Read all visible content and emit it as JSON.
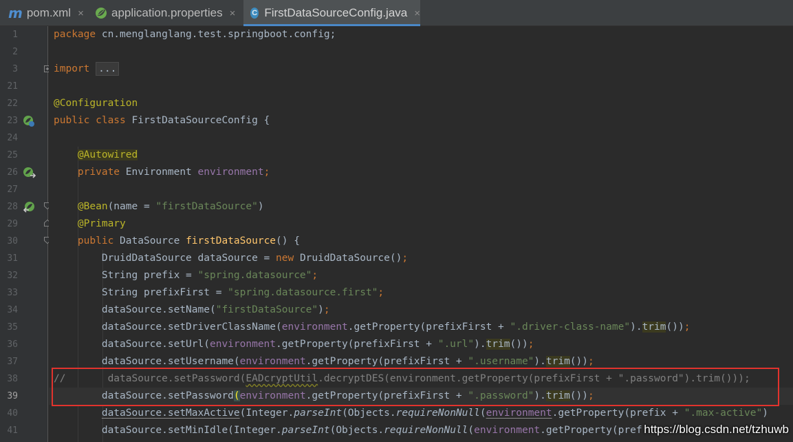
{
  "tabs": [
    {
      "label": "pom.xml",
      "icon": "maven-icon",
      "close": "×"
    },
    {
      "label": "application.properties",
      "icon": "spring-leaf-icon",
      "close": "×"
    },
    {
      "label": "FirstDataSourceConfig.java",
      "icon": "class-icon",
      "icon_glyph": "C",
      "close": "×",
      "active": true
    }
  ],
  "editor": {
    "lines": [
      {
        "num": "1"
      },
      {
        "num": "2"
      },
      {
        "num": "3"
      },
      {
        "num": "21"
      },
      {
        "num": "22"
      },
      {
        "num": "23"
      },
      {
        "num": "24"
      },
      {
        "num": "25"
      },
      {
        "num": "26"
      },
      {
        "num": "27"
      },
      {
        "num": "28"
      },
      {
        "num": "29"
      },
      {
        "num": "30"
      },
      {
        "num": "31"
      },
      {
        "num": "32"
      },
      {
        "num": "33"
      },
      {
        "num": "34"
      },
      {
        "num": "35"
      },
      {
        "num": "36"
      },
      {
        "num": "37"
      },
      {
        "num": "38"
      },
      {
        "num": "39"
      },
      {
        "num": "40"
      },
      {
        "num": "41"
      }
    ],
    "code": {
      "l1_kw": "package",
      "l1_rest": " cn.menglanglang.test.springboot.config;",
      "l3_kw": "import",
      "l3_fold": "...",
      "l22_ann": "@Configuration",
      "l23_kw": "public class",
      "l23_rest": " FirstDataSourceConfig {",
      "l25_ann": "@Autowired",
      "l26_kw": "private",
      "l26_type": " Environment ",
      "l26_field": "environment",
      "l26_semi": ";",
      "l28_ann": "@Bean",
      "l28_open": "(name = ",
      "l28_str": "\"firstDataSource\"",
      "l28_close": ")",
      "l29_ann": "@Primary",
      "l30_kw": "public",
      "l30_type": " DataSource ",
      "l30_fn": "firstDataSource",
      "l30_rest": "() {",
      "l31_a": "DruidDataSource dataSource = ",
      "l31_kw": "new",
      "l31_b": " DruidDataSource()",
      "l31_semi": ";",
      "l32_a": "String prefix = ",
      "l32_str": "\"spring.datasource\"",
      "l32_semi": ";",
      "l33_a": "String prefixFirst = ",
      "l33_str": "\"spring.datasource.first\"",
      "l33_semi": ";",
      "l34_a": "dataSource.setName(",
      "l34_str": "\"firstDataSource\"",
      "l34_b": ")",
      "l34_semi": ";",
      "l35_a": "dataSource.setDriverClassName(",
      "l35_fld": "environment",
      "l35_b": ".getProperty(prefixFirst + ",
      "l35_str": "\".driver-class-name\"",
      "l35_c": ").",
      "l35_trim": "trim",
      "l35_d": "())",
      "l35_semi": ";",
      "l36_a": "dataSource.setUrl(",
      "l36_fld": "environment",
      "l36_b": ".getProperty(prefixFirst + ",
      "l36_str": "\".url\"",
      "l36_c": ").",
      "l36_trim": "trim",
      "l36_d": "())",
      "l36_semi": ";",
      "l37_a": "dataSource.setUsername(",
      "l37_fld": "environment",
      "l37_b": ".getProperty(prefixFirst + ",
      "l37_str": "\".username\"",
      "l37_c": ").",
      "l37_trim": "trim",
      "l37_d": "())",
      "l37_semi": ";",
      "l38_cm": "//",
      "l38_pad": "       ",
      "l38_a": "dataSource.setPassword(",
      "l38_warn": "EADcryptUtil",
      "l38_b": ".decryptDES(environment.getProperty(prefixFirst + \".password\").trim()));",
      "l39_a": "dataSource.setPassword",
      "l39_paren": "(",
      "l39_fld": "environment",
      "l39_b": ".getProperty(prefixFirst + ",
      "l39_str": "\".password\"",
      "l39_c": ").",
      "l39_trim": "trim",
      "l39_d": "())",
      "l39_semi": ";",
      "l40_a": "dataSource.setMaxActive",
      "l40_b": "(Integer.",
      "l40_pi": "parseInt",
      "l40_c": "(Objects.",
      "l40_rnn": "requireNonNull",
      "l40_d": "(",
      "l40_fld": "environment",
      "l40_e": ".getProperty(prefix + ",
      "l40_str": "\".max-active\"",
      "l40_f": ")",
      "l41_a": "dataSource.setMinIdle(Integer.",
      "l41_pi": "parseInt",
      "l41_b": "(Objects.",
      "l41_rnn": "requireNonNull",
      "l41_c": "(",
      "l41_fld": "environment",
      "l41_d": ".getProperty(pref"
    }
  },
  "watermark": "https://blog.csdn.net/tzhuwb"
}
